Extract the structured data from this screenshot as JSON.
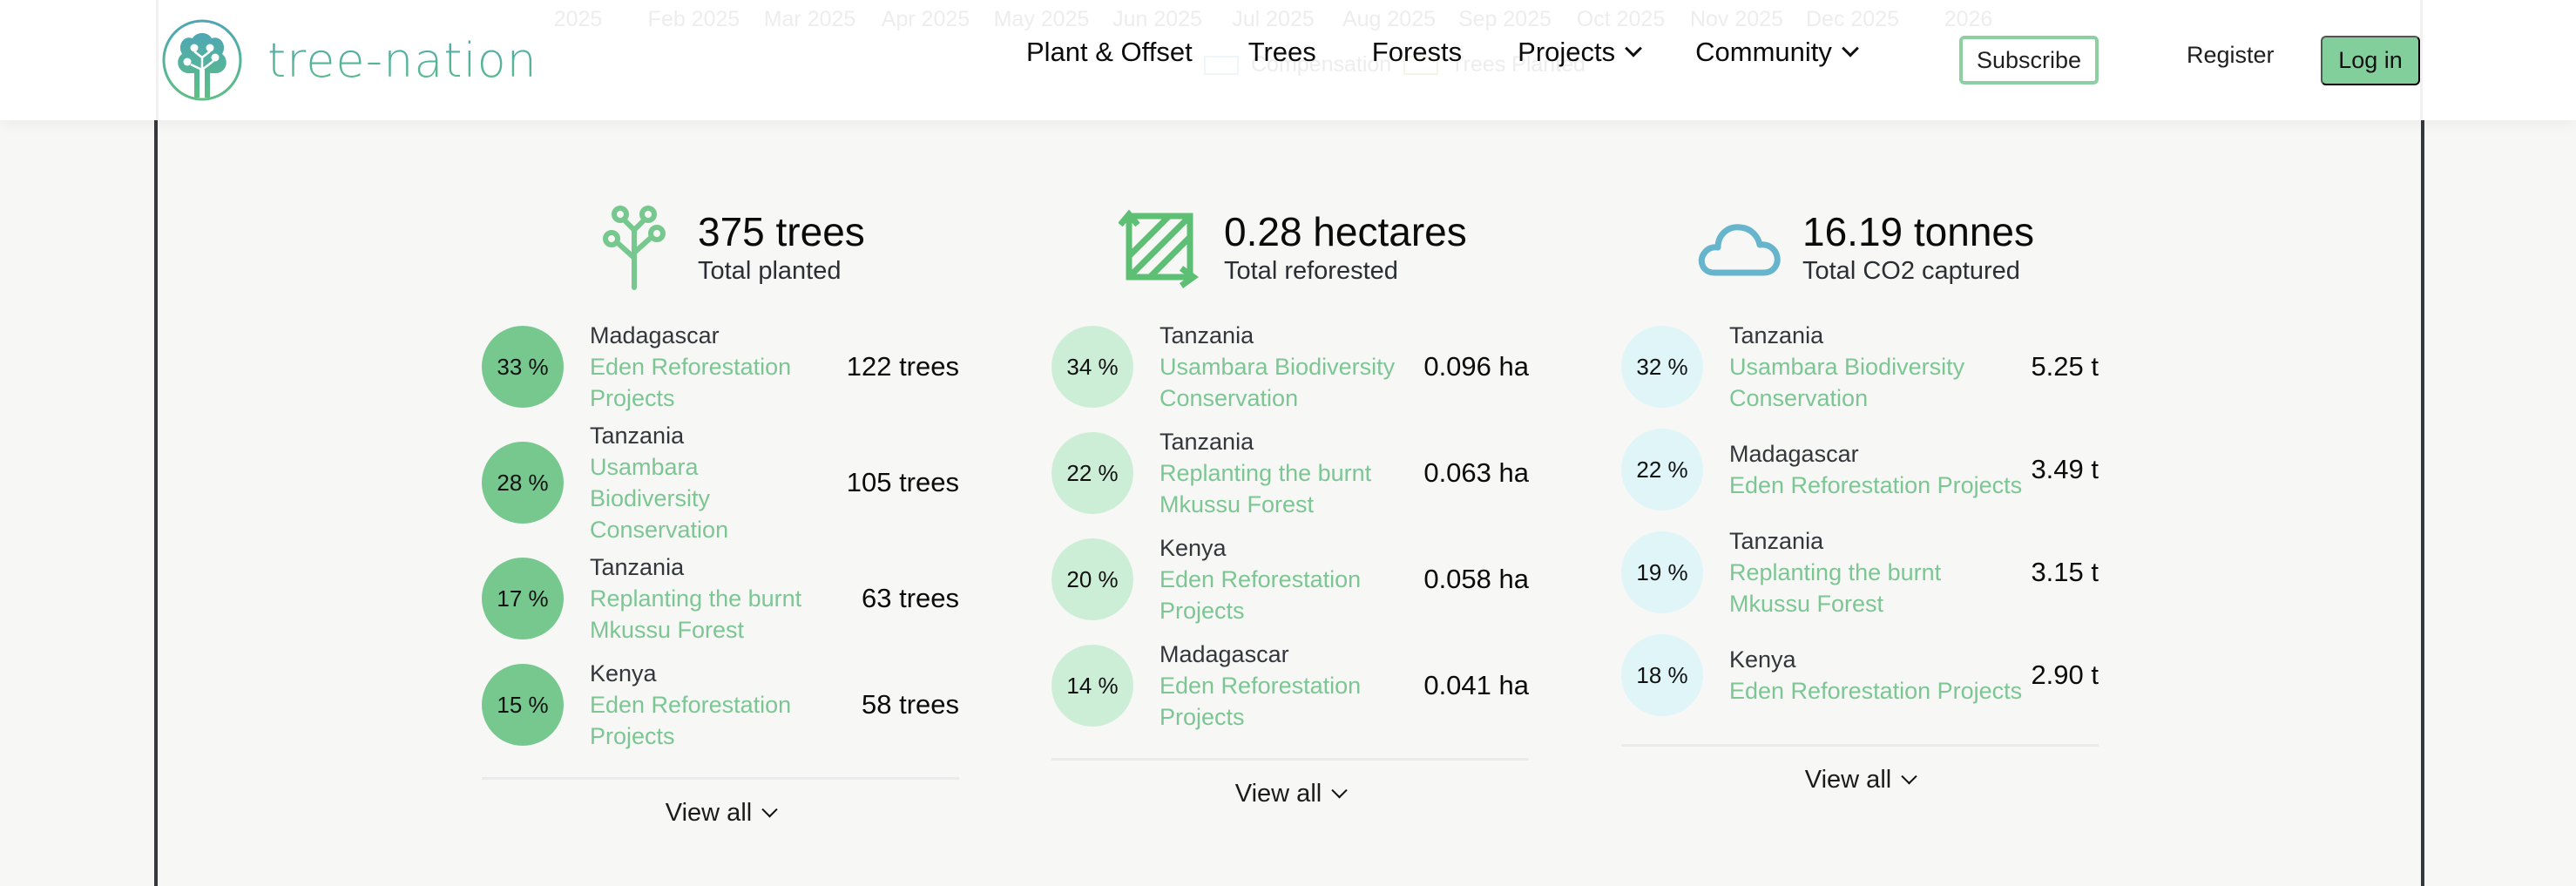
{
  "background_chart_ghost": {
    "x_ticks": [
      "2025",
      "Feb 2025",
      "Mar 2025",
      "Apr 2025",
      "May 2025",
      "Jun 2025",
      "Jul 2025",
      "Aug 2025",
      "Sep 2025",
      "Oct 2025",
      "Nov 2025",
      "Dec 2025",
      "2026"
    ],
    "legend": [
      "Compensation",
      "Trees Planted"
    ]
  },
  "header": {
    "logo_text": "tree-nation",
    "nav": [
      {
        "label": "Plant & Offset",
        "has_dropdown": false
      },
      {
        "label": "Trees",
        "has_dropdown": false
      },
      {
        "label": "Forests",
        "has_dropdown": false
      },
      {
        "label": "Projects",
        "has_dropdown": true
      },
      {
        "label": "Community",
        "has_dropdown": true
      }
    ],
    "subscribe_label": "Subscribe",
    "register_label": "Register",
    "login_label": "Log in"
  },
  "colors": {
    "brand_green": "#82cf9b",
    "project_link": "#7cc694",
    "trees_circle": "#76c88f",
    "hectares_circle": "#cdeed6",
    "co2_circle": "#dff5f8",
    "cloud_icon": "#66b5cc"
  },
  "stats": [
    {
      "icon": "tree-icon",
      "total": "375 trees",
      "caption": "Total planted",
      "rows": [
        {
          "percent": "33 %",
          "country": "Madagascar",
          "project": "Eden Reforestation Projects",
          "amount": "122 trees"
        },
        {
          "percent": "28 %",
          "country": "Tanzania",
          "project": "Usambara Biodiversity Conservation",
          "amount": "105 trees"
        },
        {
          "percent": "17 %",
          "country": "Tanzania",
          "project": "Replanting the burnt Mkussu Forest",
          "amount": "63 trees"
        },
        {
          "percent": "15 %",
          "country": "Kenya",
          "project": "Eden Reforestation Projects",
          "amount": "58 trees"
        }
      ],
      "view_all": "View all"
    },
    {
      "icon": "area-expand-icon",
      "total": "0.28 hectares",
      "caption": "Total reforested",
      "rows": [
        {
          "percent": "34 %",
          "country": "Tanzania",
          "project": "Usambara Biodiversity Conservation",
          "amount": "0.096 ha"
        },
        {
          "percent": "22 %",
          "country": "Tanzania",
          "project": "Replanting the burnt Mkussu Forest",
          "amount": "0.063 ha"
        },
        {
          "percent": "20 %",
          "country": "Kenya",
          "project": "Eden Reforestation Projects",
          "amount": "0.058 ha"
        },
        {
          "percent": "14 %",
          "country": "Madagascar",
          "project": "Eden Reforestation Projects",
          "amount": "0.041 ha"
        }
      ],
      "view_all": "View all"
    },
    {
      "icon": "cloud-icon",
      "total": "16.19 tonnes",
      "caption": "Total CO2 captured",
      "rows": [
        {
          "percent": "32 %",
          "country": "Tanzania",
          "project": "Usambara Biodiversity Conservation",
          "amount": "5.25 t"
        },
        {
          "percent": "22 %",
          "country": "Madagascar",
          "project": "Eden Reforestation Projects",
          "amount": "3.49 t"
        },
        {
          "percent": "19 %",
          "country": "Tanzania",
          "project": "Replanting the burnt Mkussu Forest",
          "amount": "3.15 t"
        },
        {
          "percent": "18 %",
          "country": "Kenya",
          "project": "Eden Reforestation Projects",
          "amount": "2.90 t"
        }
      ],
      "view_all": "View all"
    }
  ]
}
